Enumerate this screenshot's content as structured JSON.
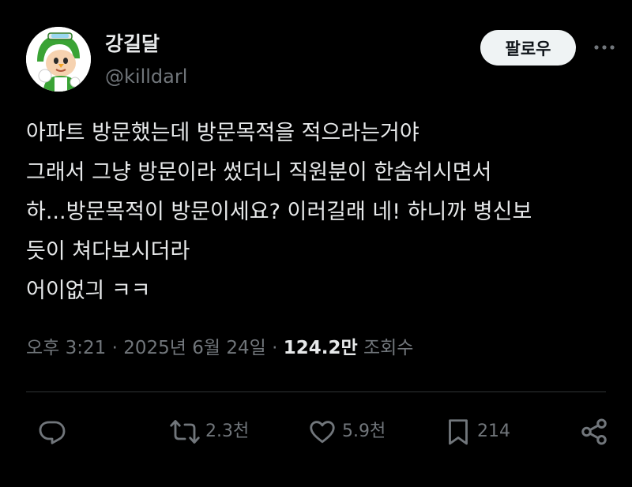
{
  "author": {
    "display_name": "강길달",
    "handle": "@killdarl"
  },
  "header": {
    "follow_label": "팔로우",
    "more_icon": "more-horizontal-icon"
  },
  "tweet": {
    "lines": [
      "아파트 방문했는데 방문목적을 적으라는거야",
      "그래서 그냥 방문이라 썼더니 직원분이 한숨쉬시면서",
      "하...방문목적이 방문이세요? 이러길래 네! 하니까 병신보",
      "듯이 쳐다보시더라",
      "어이없긔 ㅋㅋ"
    ]
  },
  "meta": {
    "time": "오후 3:21",
    "separator": " · ",
    "date": "2025년 6월 24일",
    "views_count": "124.2만",
    "views_label": "조회수"
  },
  "actions": {
    "reply": {
      "icon": "reply-icon",
      "count": ""
    },
    "retweet": {
      "icon": "retweet-icon",
      "count": "2.3천"
    },
    "like": {
      "icon": "heart-icon",
      "count": "5.9천"
    },
    "bookmark": {
      "icon": "bookmark-icon",
      "count": "214"
    },
    "share": {
      "icon": "share-icon",
      "count": ""
    }
  },
  "colors": {
    "background": "#000000",
    "text_primary": "#e7e9ea",
    "text_secondary": "#71767b",
    "divider": "#2f3336",
    "follow_button_bg": "#eff3f4",
    "follow_button_text": "#0f1419"
  }
}
